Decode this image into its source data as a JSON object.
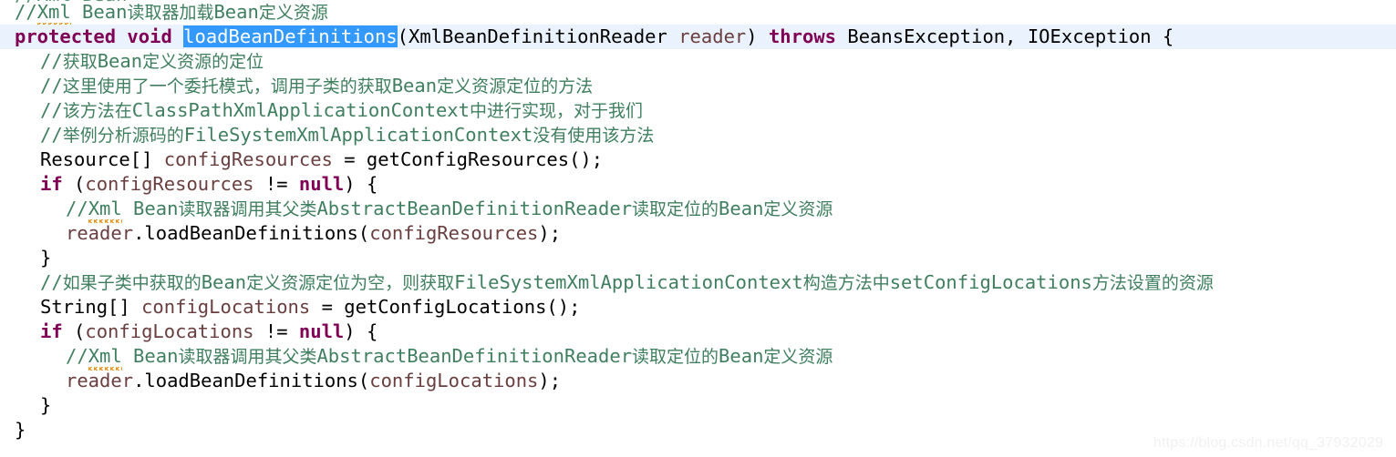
{
  "editor": {
    "language": "Java",
    "current_line_number": 2,
    "clipped_top_line": "//Xml Bean",
    "colors": {
      "background": "#ffffff",
      "keyword": "#7f0055",
      "comment": "#3f7f5f",
      "variable": "#6a3e3e",
      "plain_text": "#000000",
      "selection_background": "#3399ff",
      "selection_text": "#ffffff",
      "current_line_background": "#e9f2fd",
      "spellcheck_squiggle": "#e8900c",
      "watermark": "#f1f1f1"
    },
    "selection": {
      "text": "loadBeanDefinitions",
      "line": 2
    },
    "lines": [
      {
        "n": 1,
        "indent": 1,
        "current": false,
        "segments": [
          {
            "t": "//",
            "k": "cmt"
          },
          {
            "t": "Xml",
            "k": "cmt",
            "squiggle": true
          },
          {
            "t": " Bean",
            "k": "cmt"
          },
          {
            "t": "读取器加载",
            "k": "cmt-cjk"
          },
          {
            "t": "Bean",
            "k": "cmt"
          },
          {
            "t": "定义资源",
            "k": "cmt-cjk"
          }
        ]
      },
      {
        "n": 2,
        "indent": 1,
        "current": true,
        "segments": [
          {
            "t": "protected void ",
            "k": "kw"
          },
          {
            "t": "loadBeanDefinitions",
            "k": "sel"
          },
          {
            "t": "(",
            "k": "plain"
          },
          {
            "t": "XmlBeanDefinitionReader ",
            "k": "plain"
          },
          {
            "t": "reader",
            "k": "var"
          },
          {
            "t": ")",
            "k": "plain"
          },
          {
            "t": " throws ",
            "k": "kw"
          },
          {
            "t": "BeansException, IOException {",
            "k": "plain"
          }
        ]
      },
      {
        "n": 3,
        "indent": 2,
        "current": false,
        "segments": [
          {
            "t": "//",
            "k": "cmt"
          },
          {
            "t": "获取",
            "k": "cmt-cjk"
          },
          {
            "t": "Bean",
            "k": "cmt"
          },
          {
            "t": "定义资源的定位",
            "k": "cmt-cjk"
          }
        ]
      },
      {
        "n": 4,
        "indent": 2,
        "current": false,
        "segments": [
          {
            "t": "//",
            "k": "cmt"
          },
          {
            "t": "这里使用了一个委托模式，调用子类的获取",
            "k": "cmt-cjk"
          },
          {
            "t": "Bean",
            "k": "cmt"
          },
          {
            "t": "定义资源定位的方法",
            "k": "cmt-cjk"
          }
        ]
      },
      {
        "n": 5,
        "indent": 2,
        "current": false,
        "segments": [
          {
            "t": "//",
            "k": "cmt"
          },
          {
            "t": "该方法在",
            "k": "cmt-cjk"
          },
          {
            "t": "ClassPathXmlApplicationContext",
            "k": "cmt"
          },
          {
            "t": "中进行实现，对于我们",
            "k": "cmt-cjk"
          }
        ]
      },
      {
        "n": 6,
        "indent": 2,
        "current": false,
        "segments": [
          {
            "t": "//",
            "k": "cmt"
          },
          {
            "t": "举例分析源码的",
            "k": "cmt-cjk"
          },
          {
            "t": "FileSystemXmlApplicationContext",
            "k": "cmt"
          },
          {
            "t": "没有使用该方法",
            "k": "cmt-cjk"
          }
        ]
      },
      {
        "n": 7,
        "indent": 2,
        "current": false,
        "segments": [
          {
            "t": "Resource[] ",
            "k": "plain"
          },
          {
            "t": "configResources",
            "k": "var"
          },
          {
            "t": " = getConfigResources();",
            "k": "plain"
          }
        ]
      },
      {
        "n": 8,
        "indent": 2,
        "current": false,
        "segments": [
          {
            "t": "if",
            "k": "kw"
          },
          {
            "t": " (",
            "k": "plain"
          },
          {
            "t": "configResources",
            "k": "var"
          },
          {
            "t": " != ",
            "k": "plain"
          },
          {
            "t": "null",
            "k": "kw"
          },
          {
            "t": ") {",
            "k": "plain"
          }
        ]
      },
      {
        "n": 9,
        "indent": 3,
        "current": false,
        "segments": [
          {
            "t": "//",
            "k": "cmt"
          },
          {
            "t": "Xml",
            "k": "cmt",
            "squiggle": true
          },
          {
            "t": " Bean",
            "k": "cmt"
          },
          {
            "t": "读取器调用其父类",
            "k": "cmt-cjk"
          },
          {
            "t": "AbstractBeanDefinitionReader",
            "k": "cmt"
          },
          {
            "t": "读取定位的",
            "k": "cmt-cjk"
          },
          {
            "t": "Bean",
            "k": "cmt"
          },
          {
            "t": "定义资源",
            "k": "cmt-cjk"
          }
        ]
      },
      {
        "n": 10,
        "indent": 3,
        "current": false,
        "segments": [
          {
            "t": "reader",
            "k": "var"
          },
          {
            "t": ".loadBeanDefinitions(",
            "k": "plain"
          },
          {
            "t": "configResources",
            "k": "var"
          },
          {
            "t": ");",
            "k": "plain"
          }
        ]
      },
      {
        "n": 11,
        "indent": 2,
        "current": false,
        "segments": [
          {
            "t": "}",
            "k": "plain"
          }
        ]
      },
      {
        "n": 12,
        "indent": 2,
        "current": false,
        "segments": [
          {
            "t": "//",
            "k": "cmt"
          },
          {
            "t": "如果子类中获取的",
            "k": "cmt-cjk"
          },
          {
            "t": "Bean",
            "k": "cmt"
          },
          {
            "t": "定义资源定位为空，则获取",
            "k": "cmt-cjk"
          },
          {
            "t": "FileSystemXmlApplicationContext",
            "k": "cmt"
          },
          {
            "t": "构造方法中",
            "k": "cmt-cjk"
          },
          {
            "t": "setConfigLocations",
            "k": "cmt"
          },
          {
            "t": "方法设置的资源",
            "k": "cmt-cjk"
          }
        ]
      },
      {
        "n": 13,
        "indent": 2,
        "current": false,
        "segments": [
          {
            "t": "String[] ",
            "k": "plain"
          },
          {
            "t": "configLocations",
            "k": "var"
          },
          {
            "t": " = getConfigLocations();",
            "k": "plain"
          }
        ]
      },
      {
        "n": 14,
        "indent": 2,
        "current": false,
        "segments": [
          {
            "t": "if",
            "k": "kw"
          },
          {
            "t": " (",
            "k": "plain"
          },
          {
            "t": "configLocations",
            "k": "var"
          },
          {
            "t": " != ",
            "k": "plain"
          },
          {
            "t": "null",
            "k": "kw"
          },
          {
            "t": ") {",
            "k": "plain"
          }
        ]
      },
      {
        "n": 15,
        "indent": 3,
        "current": false,
        "segments": [
          {
            "t": "//",
            "k": "cmt"
          },
          {
            "t": "Xml",
            "k": "cmt",
            "squiggle": true
          },
          {
            "t": " Bean",
            "k": "cmt"
          },
          {
            "t": "读取器调用其父类",
            "k": "cmt-cjk"
          },
          {
            "t": "AbstractBeanDefinitionReader",
            "k": "cmt"
          },
          {
            "t": "读取定位的",
            "k": "cmt-cjk"
          },
          {
            "t": "Bean",
            "k": "cmt"
          },
          {
            "t": "定义资源",
            "k": "cmt-cjk"
          }
        ]
      },
      {
        "n": 16,
        "indent": 3,
        "current": false,
        "segments": [
          {
            "t": "reader",
            "k": "var"
          },
          {
            "t": ".loadBeanDefinitions(",
            "k": "plain"
          },
          {
            "t": "configLocations",
            "k": "var"
          },
          {
            "t": ");",
            "k": "plain"
          }
        ]
      },
      {
        "n": 17,
        "indent": 2,
        "current": false,
        "segments": [
          {
            "t": "}",
            "k": "plain"
          }
        ]
      },
      {
        "n": 18,
        "indent": 1,
        "current": false,
        "segments": [
          {
            "t": "}",
            "k": "plain"
          }
        ]
      }
    ]
  },
  "watermark": {
    "text": "https://blog.csdn.net/qq_37932029"
  }
}
